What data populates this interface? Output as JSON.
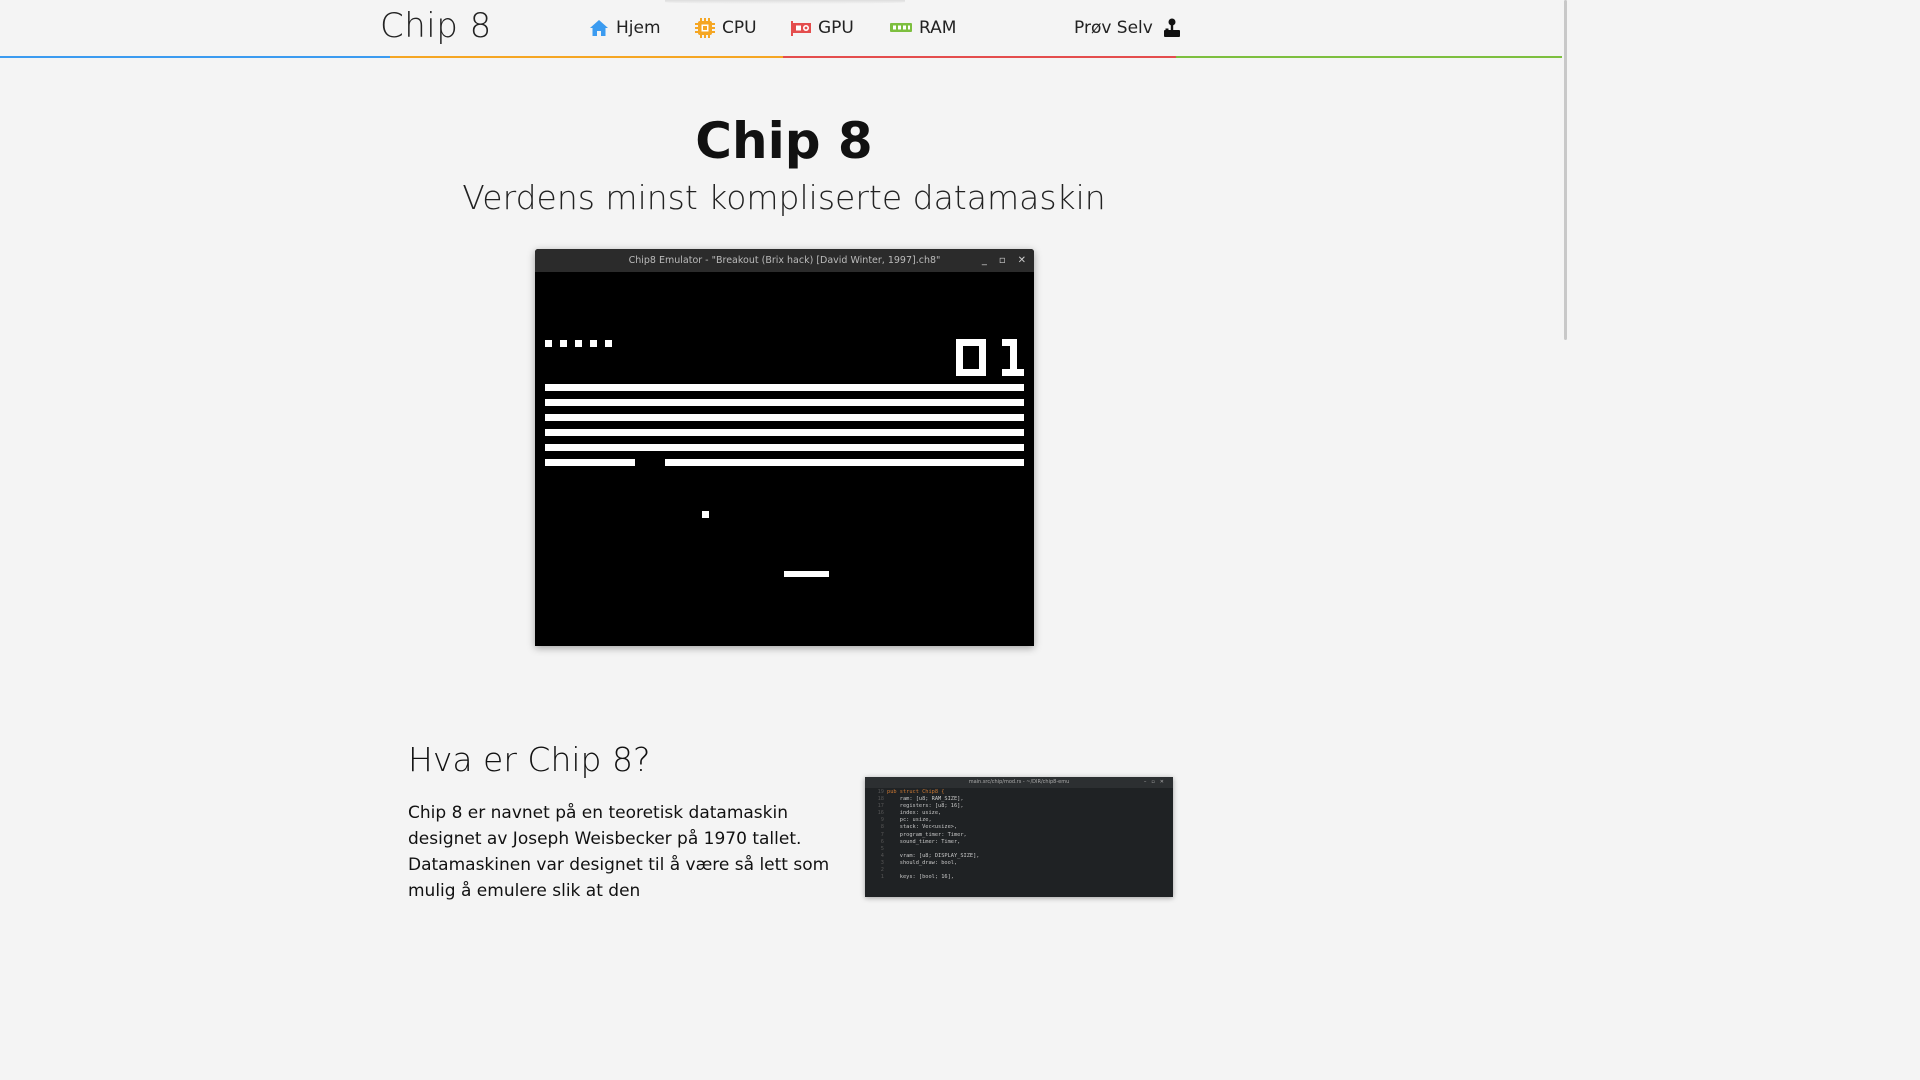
{
  "nav": {
    "brand": "Chip 8",
    "links": [
      {
        "label": "Hjem",
        "icon": "home-icon",
        "color": "#3b9bf0"
      },
      {
        "label": "CPU",
        "icon": "cpu-icon",
        "color": "#f5a623"
      },
      {
        "label": "GPU",
        "icon": "gpu-icon",
        "color": "#e44d4d"
      },
      {
        "label": "RAM",
        "icon": "ram-icon",
        "color": "#7dbf3f"
      }
    ],
    "try_label": "Prøv Selv",
    "try_icon": "joystick-icon",
    "stripe_colors": [
      "#3b9bf0",
      "#f5a623",
      "#e44d4d",
      "#7dbf3f"
    ]
  },
  "hero": {
    "title": "Chip 8",
    "subtitle": "Verdens minst kompliserte datamaskin"
  },
  "emulator": {
    "window_title": "Chip8 Emulator - \"Breakout (Brix hack) [David Winter, 1997].ch8\"",
    "buttons": [
      "_",
      "▫",
      "✕"
    ],
    "score": "01"
  },
  "section": {
    "title": "Hva er Chip 8?",
    "body": "Chip 8 er navnet på en teoretisk datamaskin designet av Joseph Weisbecker på 1970 tallet. Datamaskinen var designet til å være så lett som mulig å emulere slik at den"
  },
  "code_window": {
    "title": "main.src/chip/mod.rs - ~/DIR/chip8-emu",
    "lines": [
      {
        "n": "19",
        "code": "pub struct Chip8 {"
      },
      {
        "n": "18",
        "code": "    ram: [u8; RAM_SIZE],"
      },
      {
        "n": "17",
        "code": "    registers: [u8; 16],"
      },
      {
        "n": "16",
        "code": "    index: usize,"
      },
      {
        "n": "9",
        "code": "    pc: usize,"
      },
      {
        "n": "8",
        "code": "    stack: Vec<usize>,"
      },
      {
        "n": "7",
        "code": "    program_timer: Timer,"
      },
      {
        "n": "6",
        "code": "    sound_timer: Timer,"
      },
      {
        "n": "5",
        "code": ""
      },
      {
        "n": "4",
        "code": "    vram: [u8; DISPLAY_SIZE],"
      },
      {
        "n": "3",
        "code": "    should_draw: bool,"
      },
      {
        "n": "2",
        "code": ""
      },
      {
        "n": "1",
        "code": "    keys: [bool; 16],"
      }
    ]
  }
}
